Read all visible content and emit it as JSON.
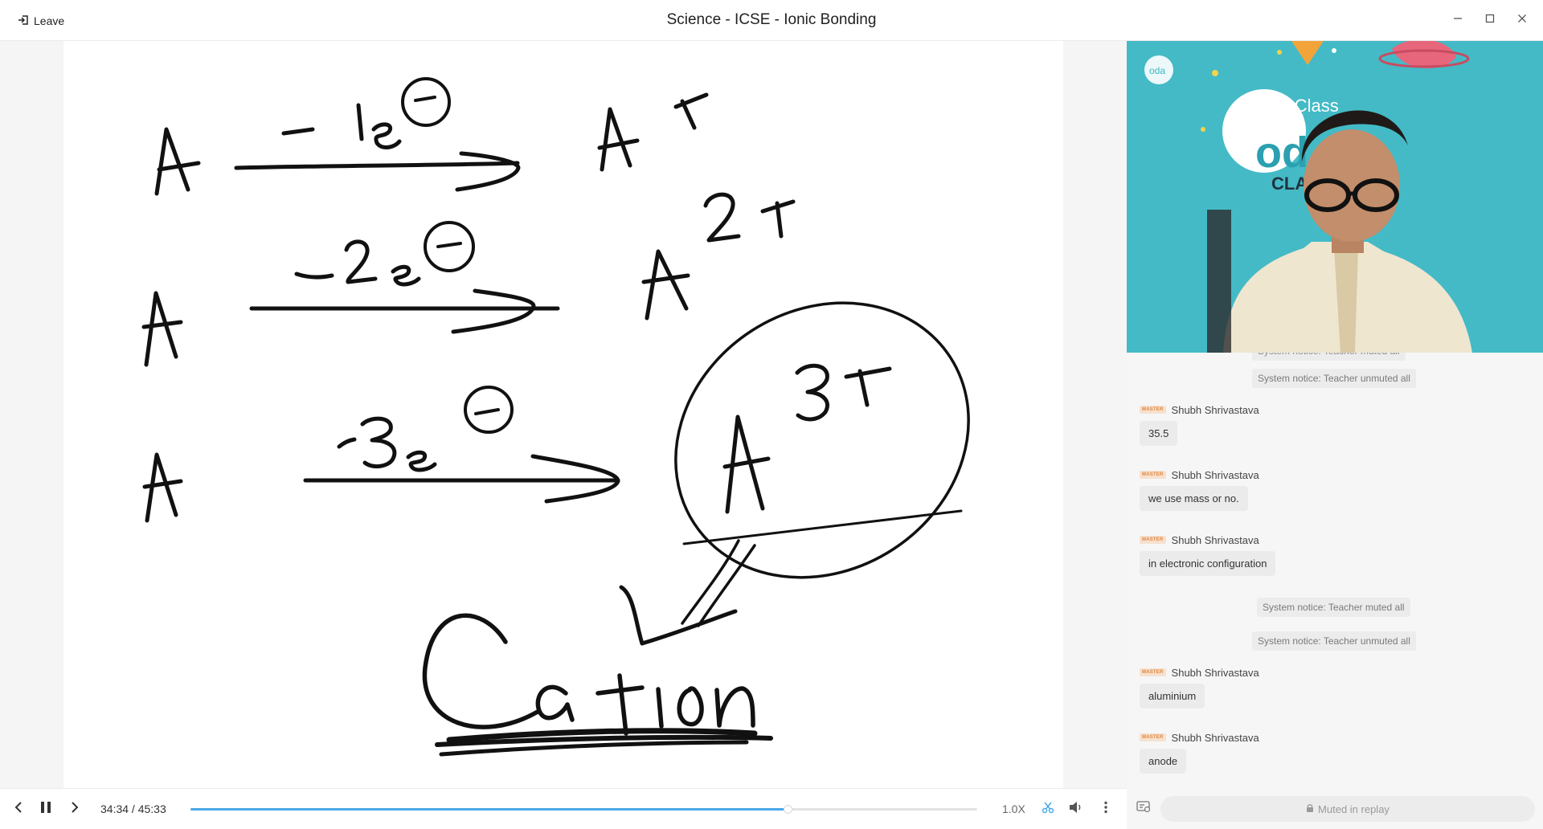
{
  "titlebar": {
    "leave_label": "Leave",
    "title": "Science - ICSE - Ionic Bonding"
  },
  "video": {
    "brand_text": "Oda Class",
    "backdrop_text_1": "od",
    "backdrop_text_2": "CLAS"
  },
  "chat": {
    "partial_notice": "System notice: Teacher muted all",
    "notice_unmuted_1": "System notice: Teacher unmuted all",
    "notice_muted_2": "System notice: Teacher muted all",
    "notice_unmuted_2": "System notice: Teacher unmuted all",
    "badge_text": "MASTER",
    "messages": [
      {
        "sender": "Shubh Shrivastava",
        "text": "35.5"
      },
      {
        "sender": "Shubh Shrivastava",
        "text": "we use mass or no."
      },
      {
        "sender": "Shubh Shrivastava",
        "text": "in electronic configuration"
      },
      {
        "sender": "Shubh Shrivastava",
        "text": "aluminium"
      },
      {
        "sender": "Shubh Shrivastava",
        "text": "anode"
      }
    ],
    "muted_label": "Muted in replay"
  },
  "player": {
    "current_time": "34:34",
    "total_time": "45:33",
    "time_display": "34:34 / 45:33",
    "progress_fraction": 0.759,
    "speed": "1.0X"
  },
  "board": {
    "lines": [
      "A  -1e⊖ → A+",
      "A  -2e⊖ → A2+",
      "A  -3e⊖ → A3+"
    ],
    "heading": "Cation"
  },
  "colors": {
    "accent": "#4aa8e8",
    "badge": "#e2853c",
    "video_bg": "#3fb6c2"
  },
  "icons": [
    "leave-icon",
    "minimize-icon",
    "maximize-icon",
    "close-icon",
    "prev-icon",
    "pause-icon",
    "next-icon",
    "scissors-icon",
    "volume-icon",
    "more-icon",
    "chat-settings-icon",
    "lock-icon"
  ]
}
